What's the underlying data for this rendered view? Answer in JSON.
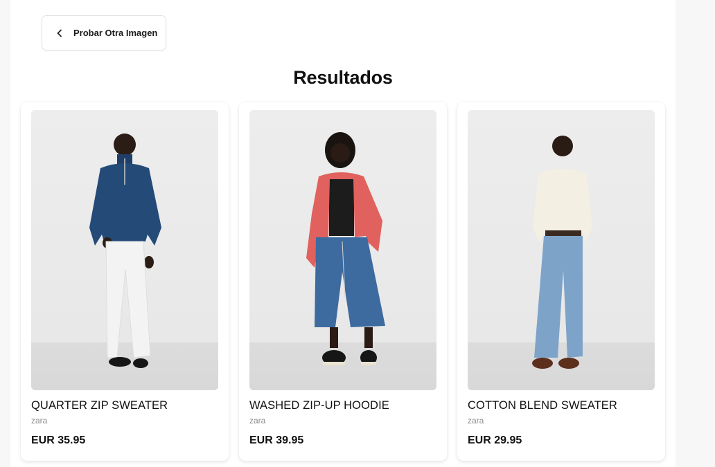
{
  "back_button": {
    "label": "Probar Otra Imagen",
    "icon": "chevron-left-icon"
  },
  "results": {
    "title": "Resultados"
  },
  "products": [
    {
      "name": "QUARTER ZIP SWEATER",
      "brand": "zara",
      "price": "EUR 35.95"
    },
    {
      "name": "WASHED ZIP-UP HOODIE",
      "brand": "zara",
      "price": "EUR 39.95"
    },
    {
      "name": "COTTON BLEND SWEATER",
      "brand": "zara",
      "price": "EUR 29.95"
    }
  ],
  "colors": {
    "page_background": "#f7f7f8",
    "panel_background": "#ffffff",
    "card_border": "#e2e2e5",
    "brand_text": "#8a8a8a"
  }
}
